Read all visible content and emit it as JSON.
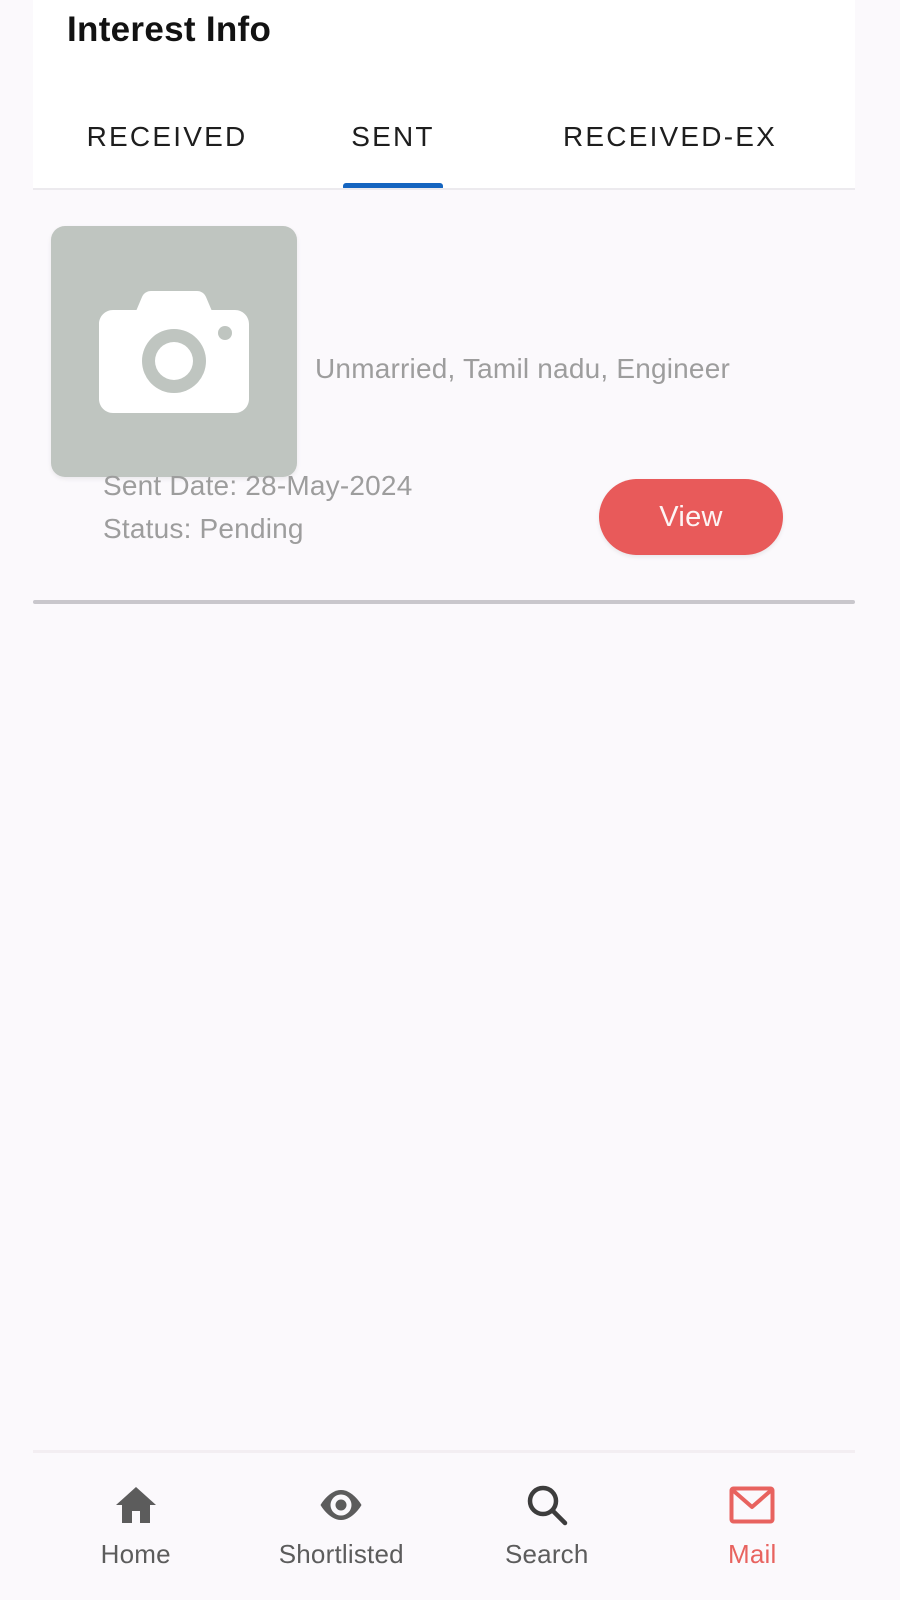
{
  "header": {
    "title": "Interest Info"
  },
  "tabs": [
    {
      "label": "RECEIVED",
      "active": false,
      "name": "tab-received"
    },
    {
      "label": "SENT",
      "active": true,
      "name": "tab-sent"
    },
    {
      "label": "RECEIVED-EX",
      "active": false,
      "name": "tab-received-ex"
    }
  ],
  "accent": {
    "tab_indicator": "#1565c0",
    "primary_button": "#e85a5a",
    "active_nav": "#e8635f",
    "placeholder_bg": "#bfc5c0",
    "muted_text": "#9d9d9d",
    "page_bg": "#fbf9fc"
  },
  "card": {
    "photo_icon": "camera-icon",
    "profile_meta": "Unmarried, Tamil nadu, Engineer",
    "sent_date": "Sent Date: 28-May-2024",
    "status": "Status: Pending",
    "view_label": "View"
  },
  "bottom_nav": [
    {
      "label": "Home",
      "icon": "home-icon",
      "active": false
    },
    {
      "label": "Shortlisted",
      "icon": "eye-icon",
      "active": false
    },
    {
      "label": "Search",
      "icon": "search-icon",
      "active": false
    },
    {
      "label": "Mail",
      "icon": "mail-icon",
      "active": true
    }
  ]
}
